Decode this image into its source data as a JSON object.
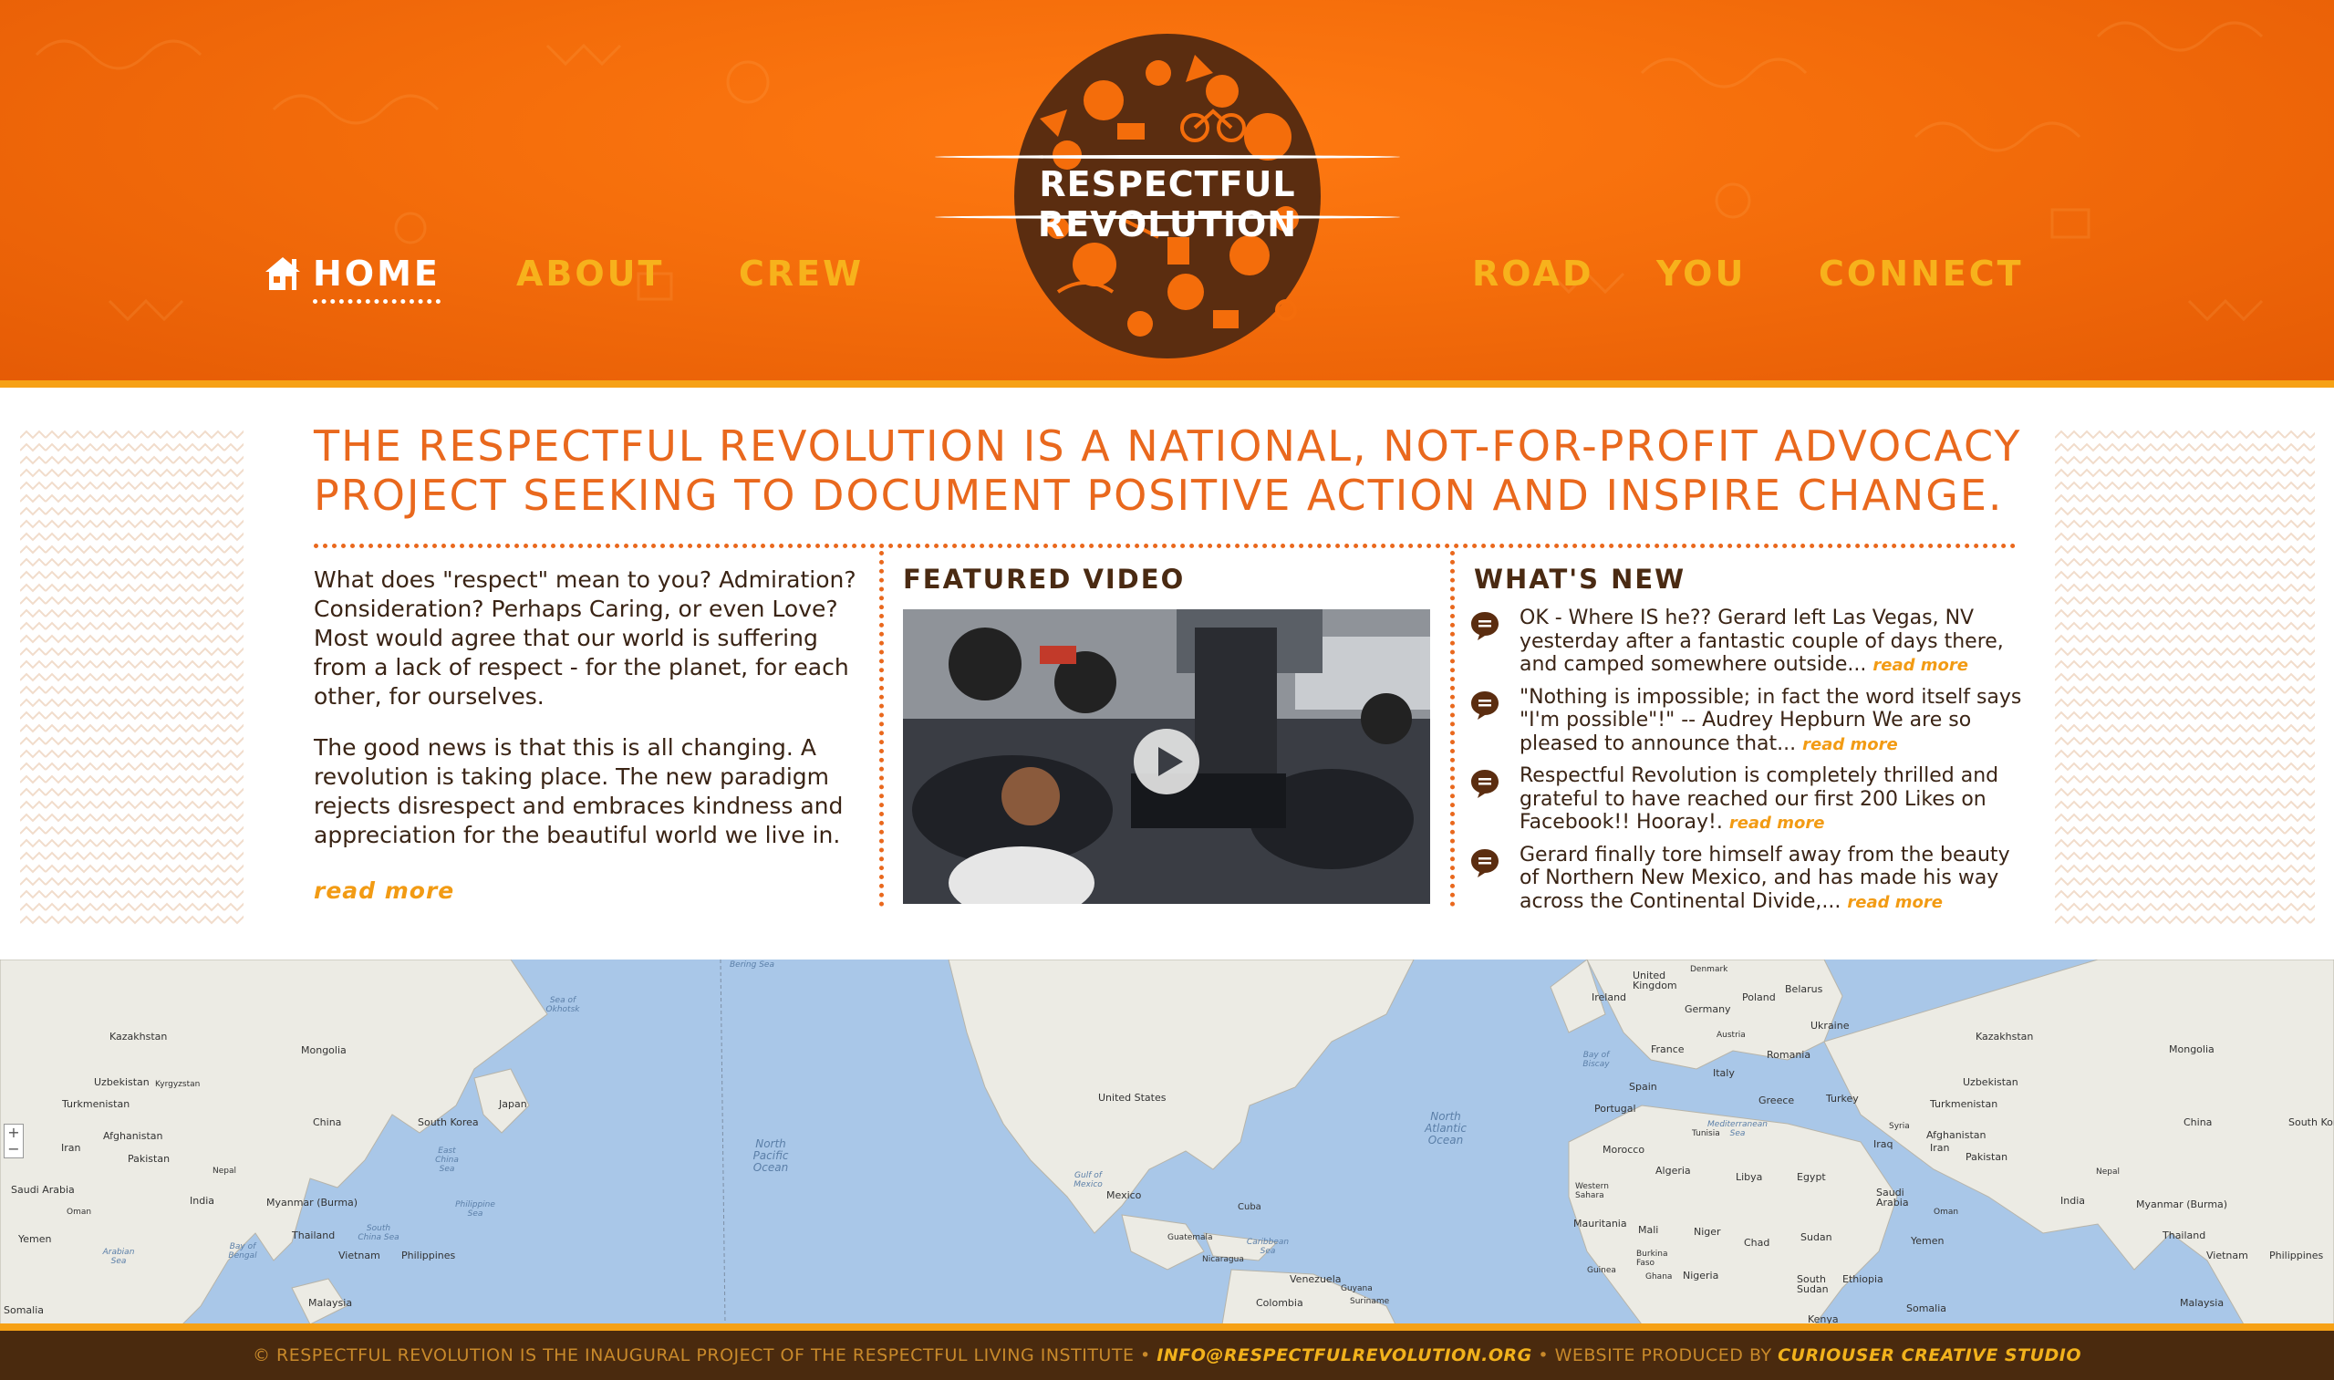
{
  "header": {
    "logo_title": "RESPECTFUL REVOLUTION",
    "nav": {
      "home": "HOME",
      "about": "ABOUT",
      "crew": "CREW",
      "road": "ROAD",
      "you": "YOU",
      "connect": "CONNECT"
    }
  },
  "tagline": {
    "line1": "THE RESPECTFUL REVOLUTION IS A NATIONAL, NOT-FOR-PROFIT ADVOCACY",
    "line2": "PROJECT SEEKING TO DOCUMENT POSITIVE ACTION AND INSPIRE CHANGE."
  },
  "intro": {
    "p1": "What does \"respect\" mean to you? Admiration? Consideration? Perhaps Caring, or even Love? Most would agree that our world is suffering from a lack of respect - for the planet, for each other, for ourselves.",
    "p2": "The good news is that this is all changing. A revolution is taking place. The new paradigm rejects disrespect and embraces kindness and appreciation for the beautiful world we live in.",
    "read_more": "read more"
  },
  "featured_video": {
    "title": "FEATURED VIDEO"
  },
  "whats_new": {
    "title": "WHAT'S NEW",
    "items": [
      {
        "text": "OK - Where IS he?? Gerard left Las Vegas, NV yesterday after a fantastic couple of days there, and camped somewhere outside...",
        "read_more": "read more"
      },
      {
        "text": "\"Nothing is impossible; in fact the word itself says \"I'm possible\"!\" -- Audrey Hepburn We are so pleased to announce that...",
        "read_more": "read more"
      },
      {
        "text": "Respectful Revolution is completely thrilled and grateful to have reached our first 200 Likes on Facebook!! Hooray!.",
        "read_more": "read more"
      },
      {
        "text": "Gerard finally tore himself away from the beauty of Northern New Mexico, and has made his way across the Continental Divide,...",
        "read_more": "read more"
      }
    ]
  },
  "map": {
    "labels": {
      "kazakhstan": "Kazakhstan",
      "mongolia": "Mongolia",
      "uzbekistan": "Uzbekistan",
      "kyrgyzstan": "Kyrgyzstan",
      "turkmenistan": "Turkmenistan",
      "afghanistan": "Afghanistan",
      "china": "China",
      "south_korea": "South Korea",
      "japan": "Japan",
      "iran": "Iran",
      "pakistan": "Pakistan",
      "nepal": "Nepal",
      "india": "India",
      "saudi_arabia": "Saudi Arabia",
      "oman": "Oman",
      "yemen": "Yemen",
      "myanmar": "Myanmar (Burma)",
      "thailand": "Thailand",
      "vietnam": "Vietnam",
      "philippines": "Philippines",
      "malaysia": "Malaysia",
      "somalia": "Somalia",
      "united_states": "United States",
      "mexico": "Mexico",
      "cuba": "Cuba",
      "guatemala": "Guatemala",
      "nicaragua": "Nicaragua",
      "venezuela": "Venezuela",
      "colombia": "Colombia",
      "guyana": "Guyana",
      "suriname": "Suriname",
      "ireland": "Ireland",
      "united_kingdom": "United Kingdom",
      "denmark": "Denmark",
      "poland": "Poland",
      "belarus": "Belarus",
      "germany": "Germany",
      "ukraine": "Ukraine",
      "france": "France",
      "austria": "Austria",
      "romania": "Romania",
      "italy": "Italy",
      "spain": "Spain",
      "portugal": "Portugal",
      "greece": "Greece",
      "turkey": "Turkey",
      "syria": "Syria",
      "iraq": "Iraq",
      "morocco": "Morocco",
      "tunisia": "Tunisia",
      "algeria": "Algeria",
      "libya": "Libya",
      "egypt": "Egypt",
      "western_sahara": "Western Sahara",
      "mauritania": "Mauritania",
      "mali": "Mali",
      "niger": "Niger",
      "chad": "Chad",
      "sudan": "Sudan",
      "burkina_faso": "Burkina Faso",
      "nigeria": "Nigeria",
      "ghana": "Ghana",
      "guinea": "Guinea",
      "ethiopia": "Ethiopia",
      "south_sudan": "South Sudan",
      "kenya": "Kenya",
      "north_pacific": "North Pacific Ocean",
      "north_atlantic": "North Atlantic Ocean",
      "sea_of_okhotsk": "Sea of Okhotsk",
      "bering_sea": "Bering Sea",
      "east_china_sea": "East China Sea",
      "south_china_sea": "South China Sea",
      "philippine_sea": "Philippine Sea",
      "bay_of_bengal": "Bay of Bengal",
      "arabian_sea": "Arabian Sea",
      "gulf_of_mexico": "Gulf of Mexico",
      "caribbean_sea": "Caribbean Sea",
      "mediterranean": "Mediterranean Sea",
      "bay_of_biscay": "Bay of Biscay"
    }
  },
  "footer": {
    "prefix": "© RESPECTFUL REVOLUTION IS THE INAUGURAL PROJECT OF THE RESPECTFUL LIVING INSTITUTE • ",
    "email": "INFO@RESPECTFULREVOLUTION.ORG",
    "middle": " • WEBSITE PRODUCED BY ",
    "studio": "CURIOUSER CREATIVE STUDIO"
  },
  "colors": {
    "header_orange": "#f46d0b",
    "accent_yellow": "#f6a116",
    "title_orange": "#e9681d",
    "footer_brown": "#4a2a0e"
  }
}
